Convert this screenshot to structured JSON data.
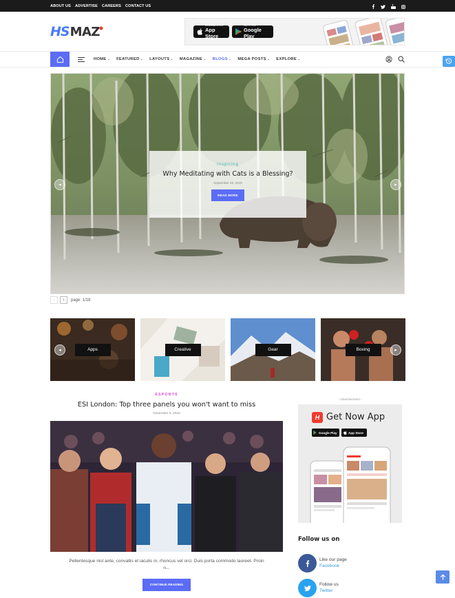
{
  "topbar": {
    "links": [
      "ABOUT US",
      "ADVERTISE",
      "CAREERS",
      "CONTACT US"
    ],
    "social_icons": [
      "facebook-icon",
      "twitter-icon",
      "youtube-icon",
      "instagram-icon"
    ]
  },
  "logo": {
    "part1": "HS",
    "part2": "MAZ"
  },
  "ad_banner": {
    "appstore_small": "Download on the",
    "appstore_big": "App Store",
    "googleplay_small": "GET IT ON",
    "googleplay_big": "Google Play"
  },
  "nav": {
    "items": [
      {
        "label": "HOME",
        "active": false
      },
      {
        "label": "FEATURED",
        "active": false
      },
      {
        "label": "LAYOUTS",
        "active": false
      },
      {
        "label": "MAGAZINE",
        "active": false
      },
      {
        "label": "BLOGS",
        "active": true
      },
      {
        "label": "MEGA POSTS",
        "active": false
      },
      {
        "label": "EXPLORE",
        "active": false
      }
    ],
    "caret": "⌄",
    "accent": "#5b6cf5"
  },
  "hero": {
    "category": "Inspiring",
    "title": "Why Meditating with Cats is a Blessing?",
    "date": "September 28, 2019",
    "button": "READ MORE"
  },
  "pager": {
    "text": "page: 1/18"
  },
  "categories": [
    "Apps",
    "Creative",
    "Gear",
    "Boxing"
  ],
  "post": {
    "category": "ESPORTS",
    "title": "ESI London: Top three panels you won't want to miss",
    "date": "November 9, 2019",
    "excerpt_line1": "Pellentesque nisl ante, convallis et iaculis in, rhoncus vel orci. Duis porta commodo laoreet. Proin",
    "excerpt_line2": "n...",
    "button": "CONTINUE READING"
  },
  "sidebar": {
    "ad_label": "- Advertisement -",
    "app_title": "Get Now App",
    "app_logo_letter": "H",
    "googleplay": "Google Play",
    "appstore": "App Store",
    "follow_title": "Follow us on",
    "social": [
      {
        "line1": "Like our page",
        "line2": "Facebook",
        "color": "#3b5998",
        "icon": "facebook-icon"
      },
      {
        "line1": "Follow us",
        "line2": "Twitter",
        "color": "#29a3ef",
        "icon": "twitter-icon"
      }
    ]
  }
}
